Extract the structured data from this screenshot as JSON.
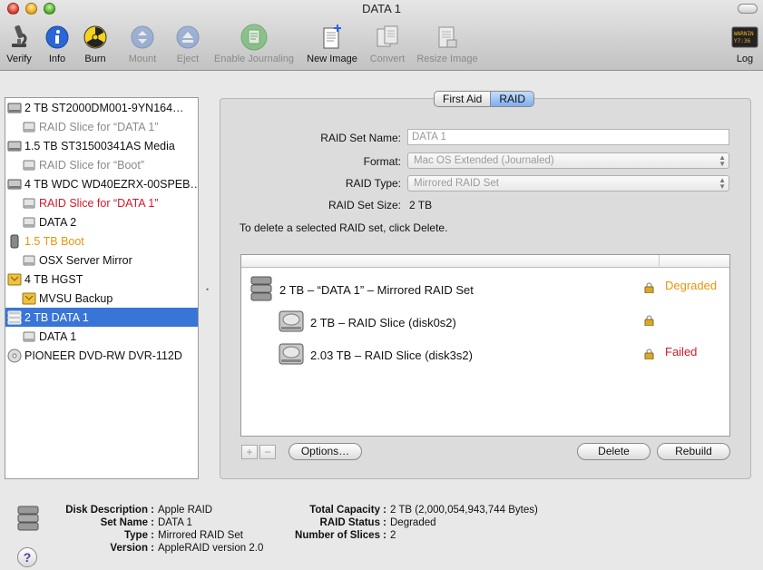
{
  "window": {
    "title": "DATA 1"
  },
  "toolbar": {
    "verify": "Verify",
    "info": "Info",
    "burn": "Burn",
    "mount": "Mount",
    "eject": "Eject",
    "enable_journaling": "Enable Journaling",
    "new_image": "New Image",
    "convert": "Convert",
    "resize_image": "Resize Image",
    "log": "Log"
  },
  "sidebar": {
    "items": [
      {
        "label": "2 TB ST2000DM001-9YN164…",
        "color": "normal"
      },
      {
        "label": "RAID Slice for “DATA 1”",
        "color": "gray"
      },
      {
        "label": "1.5 TB ST31500341AS Media",
        "color": "normal"
      },
      {
        "label": "RAID Slice for “Boot”",
        "color": "gray"
      },
      {
        "label": "4 TB WDC WD40EZRX-00SPEB…",
        "color": "normal"
      },
      {
        "label": "RAID Slice for “DATA 1”",
        "color": "red"
      },
      {
        "label": "DATA 2",
        "color": "normal"
      },
      {
        "label": "1.5 TB Boot",
        "color": "orange"
      },
      {
        "label": "OSX Server Mirror",
        "color": "normal"
      },
      {
        "label": "4 TB HGST",
        "color": "normal"
      },
      {
        "label": "MVSU Backup",
        "color": "normal"
      },
      {
        "label": "2 TB DATA 1",
        "color": "orange"
      },
      {
        "label": "DATA 1",
        "color": "normal"
      },
      {
        "label": "PIONEER DVD-RW DVR-112D",
        "color": "normal"
      }
    ]
  },
  "tabs": {
    "first_aid": "First Aid",
    "raid": "RAID"
  },
  "raid": {
    "set_name_label": "RAID Set Name:",
    "set_name_value": "DATA 1",
    "format_label": "Format:",
    "format_value": "Mac OS Extended (Journaled)",
    "type_label": "RAID Type:",
    "type_value": "Mirrored RAID Set",
    "size_label": "RAID Set Size:",
    "size_value": "2 TB",
    "delete_hint": "To delete a selected RAID set, click Delete.",
    "list": [
      {
        "label": "2 TB – “DATA 1” – Mirrored RAID Set",
        "status": "Degraded"
      },
      {
        "label": "2 TB – RAID Slice (disk0s2)",
        "status": ""
      },
      {
        "label": "2.03 TB – RAID Slice (disk3s2)",
        "status": "Failed"
      }
    ],
    "add": "+",
    "remove": "−",
    "options": "Options…",
    "delete": "Delete",
    "rebuild": "Rebuild"
  },
  "info": {
    "disk_description_label": "Disk Description :",
    "disk_description": "Apple RAID",
    "set_name_label": "Set Name :",
    "set_name": "DATA 1",
    "type_label": "Type :",
    "type": "Mirrored RAID Set",
    "version_label": "Version :",
    "version": "AppleRAID version 2.0",
    "total_capacity_label": "Total Capacity :",
    "total_capacity": "2 TB (2,000,054,943,744 Bytes)",
    "raid_status_label": "RAID Status :",
    "raid_status": "Degraded",
    "number_of_slices_label": "Number of Slices :",
    "number_of_slices": "2",
    "help": "?"
  },
  "colors": {
    "selection": "#3875d7",
    "degraded": "#e8960a",
    "failed": "#d8182a"
  }
}
